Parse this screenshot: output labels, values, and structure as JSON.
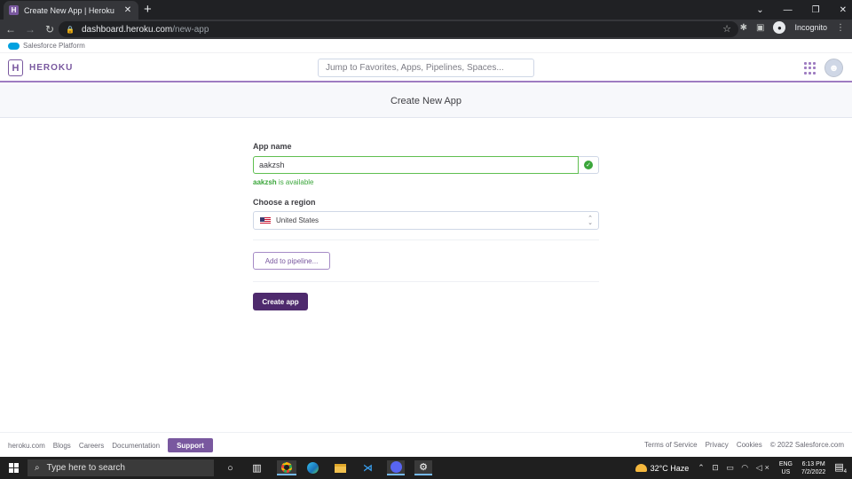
{
  "browser": {
    "tab_title": "Create New App | Heroku",
    "url_host": "dashboard.heroku.com",
    "url_path": "/new-app",
    "profile_label": "Incognito"
  },
  "salesforce_bar": {
    "label": "Salesforce Platform"
  },
  "header": {
    "logo_text": "HEROKU",
    "search_placeholder": "Jump to Favorites, Apps, Pipelines, Spaces..."
  },
  "page": {
    "title": "Create New App"
  },
  "form": {
    "app_name_label": "App name",
    "app_name_value": "aakzsh",
    "availability_name": "aakzsh",
    "availability_text": " is available",
    "region_label": "Choose a region",
    "region_value": "United States",
    "pipeline_button": "Add to pipeline...",
    "create_button": "Create app"
  },
  "footer": {
    "left_links": [
      "heroku.com",
      "Blogs",
      "Careers",
      "Documentation"
    ],
    "support_button": "Support",
    "right_links": [
      "Terms of Service",
      "Privacy",
      "Cookies",
      "© 2022 Salesforce.com"
    ]
  },
  "taskbar": {
    "search_placeholder": "Type here to search",
    "weather": "32°C  Haze",
    "lang_top": "ENG",
    "lang_bottom": "US",
    "time": "6:13 PM",
    "date": "7/2/2022",
    "notification_count": "4"
  }
}
